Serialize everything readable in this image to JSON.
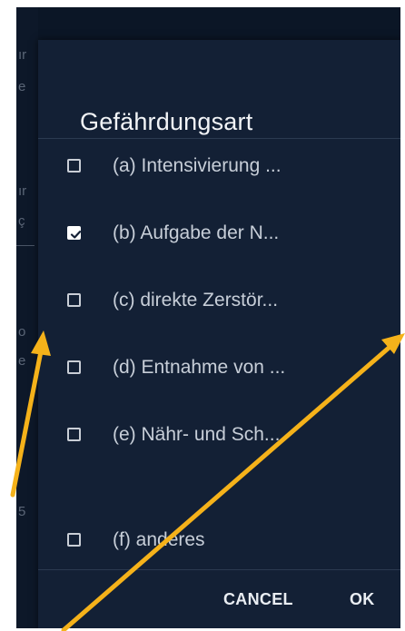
{
  "background": {
    "fragments": [
      "ır",
      "e",
      "ır",
      "ç",
      "o",
      "e",
      "5"
    ]
  },
  "dialog": {
    "title": "Gefährdungsart",
    "options": [
      {
        "label": "(a) Intensivierung ...",
        "checked": false
      },
      {
        "label": "(b) Aufgabe der N...",
        "checked": true
      },
      {
        "label": "(c) direkte Zerstör...",
        "checked": false
      },
      {
        "label": "(d) Entnahme von ...",
        "checked": false
      },
      {
        "label": "(e) Nähr- und Sch...",
        "checked": false
      },
      {
        "label": "(f) anderes",
        "checked": false
      }
    ],
    "cancel_label": "CANCEL",
    "ok_label": "OK"
  },
  "colors": {
    "dialog_bg": "#132035",
    "screen_bg": "#0b1626",
    "annotation_arrow": "#f5b21a"
  },
  "icons": {
    "checkbox_checked": "check-icon",
    "annotation": "arrow-icon"
  }
}
